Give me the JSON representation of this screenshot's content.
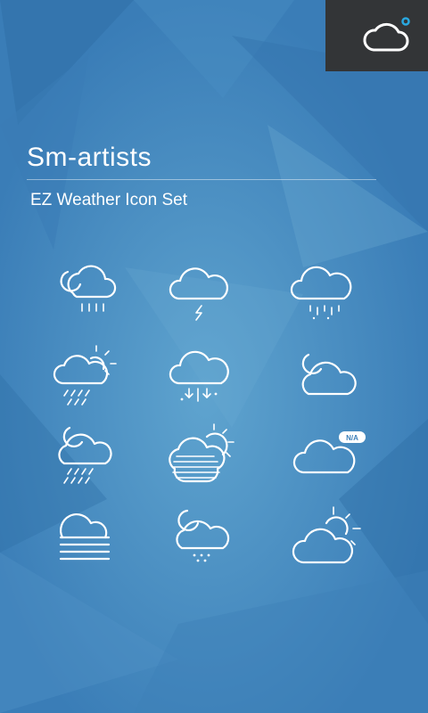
{
  "app": {
    "title": "Sm-artists",
    "subtitle": "EZ Weather Icon Set"
  },
  "corner": {
    "icon": "cloud-icon"
  },
  "icons": [
    {
      "name": "night-cloud-rain-icon"
    },
    {
      "name": "cloud-thunder-icon"
    },
    {
      "name": "cloud-sleet-icon"
    },
    {
      "name": "day-cloud-rain-icon"
    },
    {
      "name": "cloud-hail-icon"
    },
    {
      "name": "night-cloudy-icon"
    },
    {
      "name": "night-cloud-heavy-rain-icon"
    },
    {
      "name": "fog-sun-icon"
    },
    {
      "name": "cloud-na-icon",
      "badge": "N/A"
    },
    {
      "name": "fog-icon"
    },
    {
      "name": "night-cloud-snow-icon"
    },
    {
      "name": "day-cloudy-icon"
    }
  ],
  "colors": {
    "background": "#3b7fb9",
    "corner": "#333537",
    "accent": "#29a8e0",
    "icon": "#ffffff"
  }
}
